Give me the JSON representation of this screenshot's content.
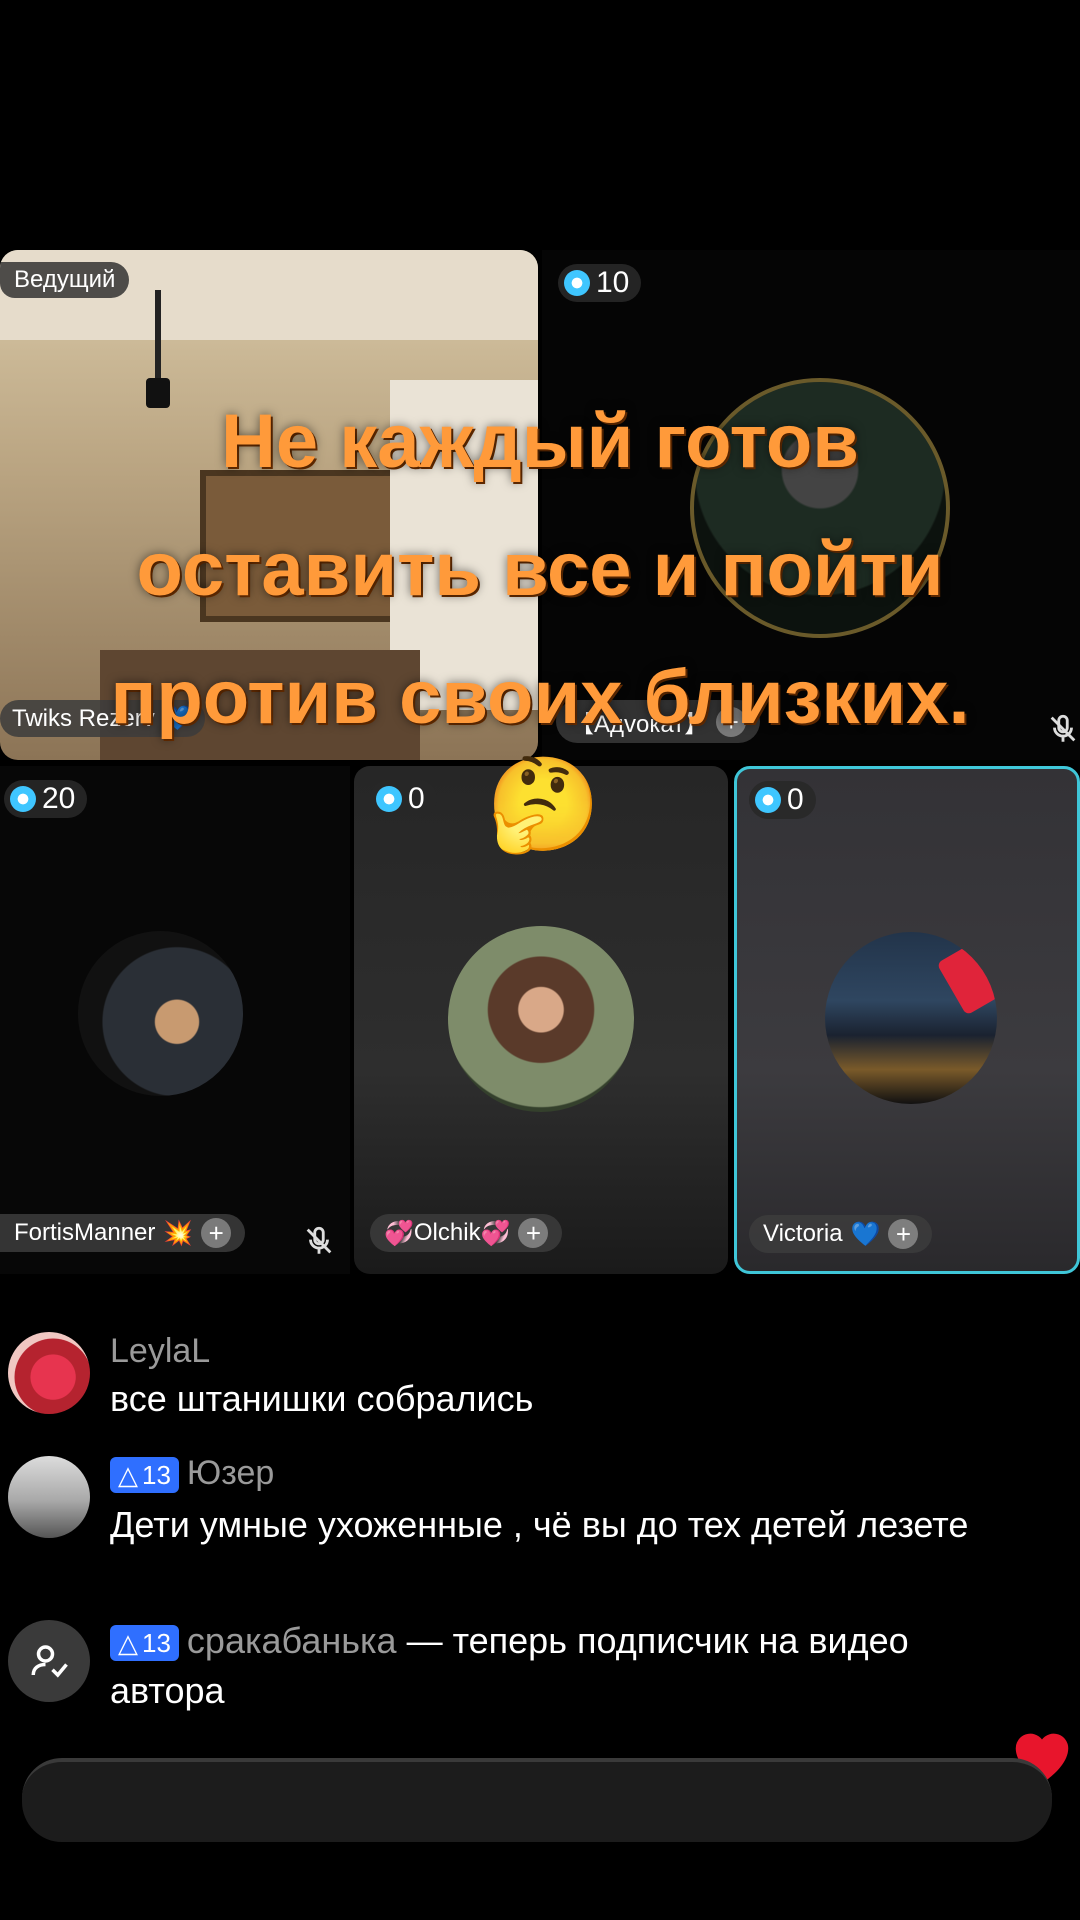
{
  "host_tile": {
    "badge": "Ведущий",
    "name": "Twiks Rezerv",
    "name_emoji": "💙"
  },
  "tiles": [
    {
      "score": "10",
      "name": "【Адvокат】"
    },
    {
      "score": "20",
      "name": "FortisManner",
      "name_emoji": "💥"
    },
    {
      "score": "0",
      "name": "Olchik",
      "name_emoji_pre": "💞",
      "name_emoji_post": "💞"
    },
    {
      "score": "0",
      "name": "Victoria",
      "name_emoji": "💙"
    }
  ],
  "caption": {
    "line1": "Не каждый готов",
    "line2": "оставить все и пойти",
    "line3": "против своих близких."
  },
  "emoji": "🤔",
  "comments": [
    {
      "user": "LeylaL",
      "text": "все штанишки собрались"
    },
    {
      "level": "13",
      "user": "Юзер",
      "text": "Дети умные ухоженные , чё вы до тех детей лезете"
    },
    {
      "level": "13",
      "user": "сракабанька",
      "text": "— теперь подписчик на видео автора"
    }
  ],
  "icons": {
    "score": "diamond-coin-icon",
    "add": "plus-icon",
    "mic": "mic-muted-icon",
    "heart": "heart-icon"
  },
  "colors": {
    "caption": "#ff9a3a",
    "accent": "#3fc6ff",
    "badge": "#2f6fff"
  }
}
